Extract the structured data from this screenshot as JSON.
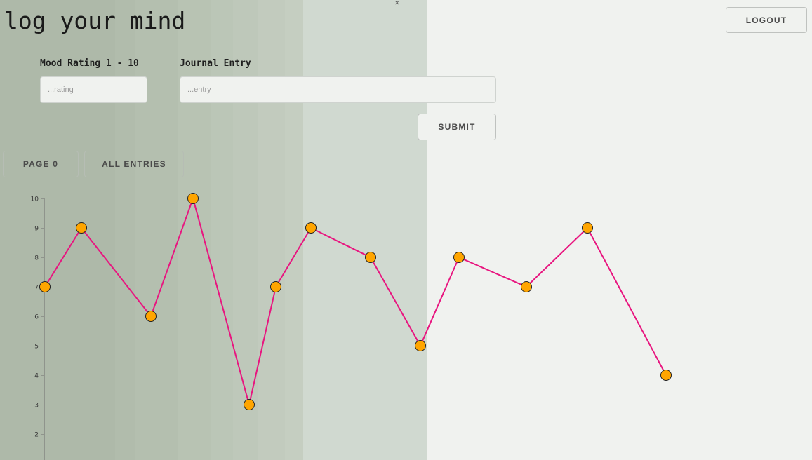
{
  "app": {
    "title": "log your mind"
  },
  "header": {
    "logout_label": "LOGOUT"
  },
  "form": {
    "rating_label": "Mood Rating 1 - 10",
    "rating_placeholder": "...rating",
    "entry_label": "Journal Entry",
    "entry_placeholder": "...entry",
    "submit_label": "SUBMIT"
  },
  "nav": {
    "page_label": "PAGE 0",
    "all_entries_label": "ALL ENTRIES"
  },
  "colors": {
    "line": "#e8157f",
    "point_fill": "#ffa500",
    "point_stroke": "#222222",
    "background": "#f0f2ef"
  },
  "chart_data": {
    "type": "line",
    "y_ticks": [
      "2",
      "3",
      "4",
      "5",
      "6",
      "7",
      "8",
      "9",
      "10"
    ],
    "ylim": [
      1,
      10
    ],
    "series": [
      {
        "values": [
          7,
          9,
          6,
          10,
          3,
          7,
          9,
          8,
          5,
          8,
          7,
          9,
          4
        ]
      }
    ]
  }
}
